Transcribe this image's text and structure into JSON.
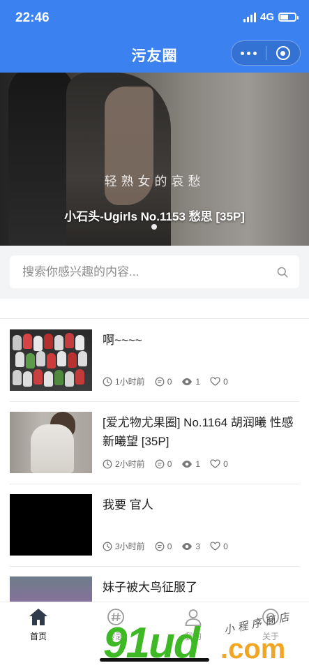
{
  "status_bar": {
    "time": "22:46",
    "network": "4G",
    "battery_level": 0.55
  },
  "nav": {
    "title": "污友圈"
  },
  "banner": {
    "subtitle": "轻熟女的哀愁",
    "title": "小石头-Ugirls No.1153 愁思 [35P]"
  },
  "search": {
    "placeholder": "搜索你感兴趣的内容..."
  },
  "posts": [
    {
      "title": "啊~~~~",
      "time": "1小时前",
      "comments": "0",
      "views": "1",
      "likes": "0"
    },
    {
      "title": "[爱尤物尤果圈] No.1164 胡润曦 性感新曦望 [35P]",
      "time": "2小时前",
      "comments": "0",
      "views": "1",
      "likes": "0"
    },
    {
      "title": "我要 官人",
      "time": "3小时前",
      "comments": "0",
      "views": "3",
      "likes": "0"
    },
    {
      "title": "妹子被大鸟征服了"
    }
  ],
  "tabbar": [
    {
      "label": "首页",
      "icon": "home-icon"
    },
    {
      "label": "专题",
      "icon": "hashtag-icon"
    },
    {
      "label": "我的",
      "icon": "user-icon"
    },
    {
      "label": "关于",
      "icon": "target-icon"
    }
  ],
  "watermark": {
    "big": "91ud",
    "com": ".com",
    "small": "小程序商店"
  },
  "colors": {
    "primary": "#3b82f0",
    "watermark_green": "#3fb826",
    "watermark_orange": "#f0a623"
  }
}
